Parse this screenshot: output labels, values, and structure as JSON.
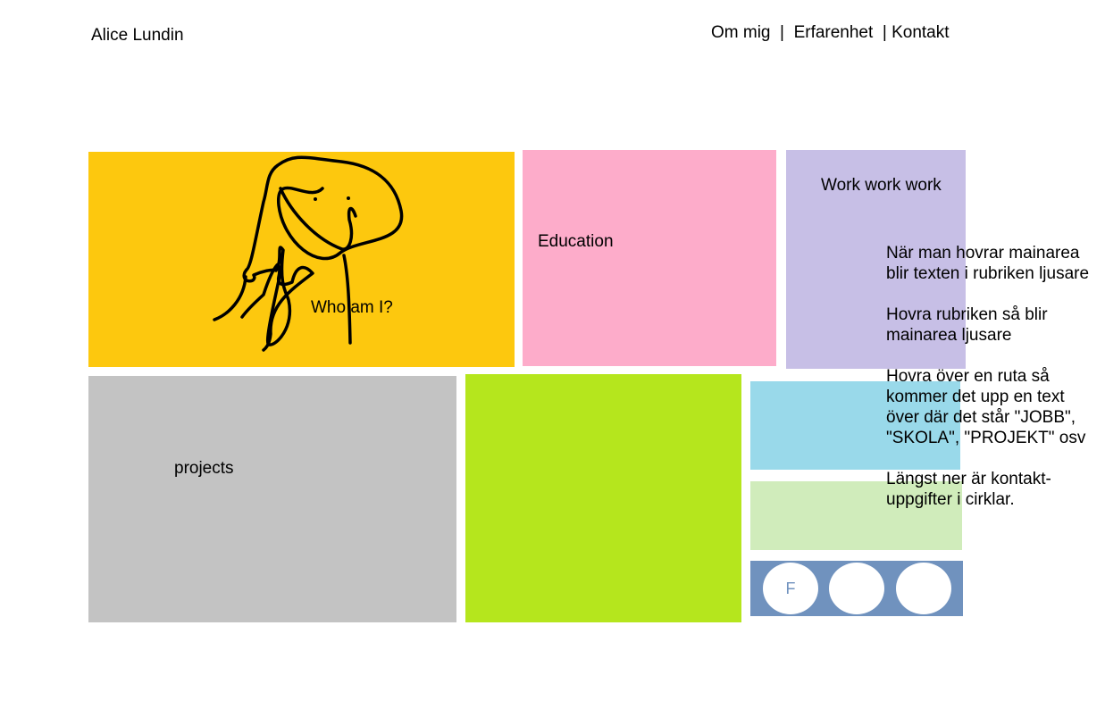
{
  "header": {
    "site_title": "Alice Lundin",
    "nav": {
      "about": "Om mig",
      "sep1": "  |  ",
      "experience": "Erfarenhet",
      "sep2": "  | ",
      "contact": "Kontakt"
    }
  },
  "tiles": {
    "who": {
      "label": "Who am I?",
      "color": "#fdc80e"
    },
    "education": {
      "label": "Education",
      "color": "#fdacca"
    },
    "work": {
      "label": "Work work work",
      "color": "#c7bfe6"
    },
    "projects": {
      "label": "projects",
      "color": "#c3c3c3"
    },
    "lime": {
      "color": "#b5e61d"
    },
    "cyan": {
      "color": "#99d9ea"
    },
    "mint": {
      "color": "#d0ecbb"
    },
    "contact": {
      "color": "#7092be",
      "circles": [
        {
          "label": "F",
          "icon": "facebook-icon",
          "text_color": "#7092be"
        },
        {
          "label": "",
          "icon": "contact-circle-icon"
        },
        {
          "label": "",
          "icon": "contact-circle-icon"
        }
      ]
    }
  },
  "notes": [
    "När man hovrar mainarea blir texten i rubriken ljusare",
    "Hovra rubriken så blir mainarea ljusare",
    "Hovra över en ruta så kommer det upp en text över där det står \"JOBB\", \"SKOLA\", \"PROJEKT\" osv",
    "Längst ner är kontakt-uppgifter i cirklar."
  ]
}
